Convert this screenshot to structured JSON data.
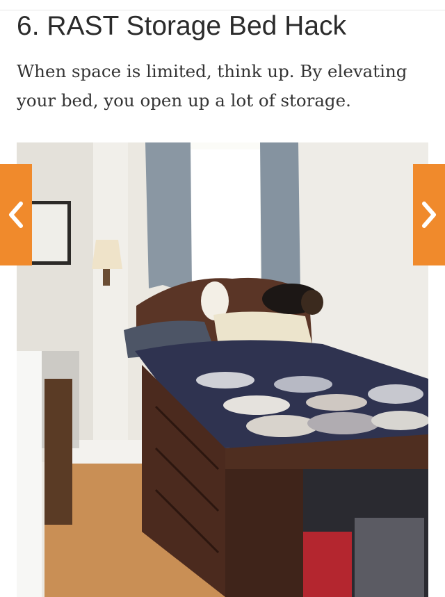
{
  "article": {
    "title": "6. RAST Storage Bed Hack",
    "description": "When space is limited, think up. By elevating your bed, you open up a lot of storage."
  },
  "gallery": {
    "prev_icon": "chevron-left-icon",
    "next_icon": "chevron-right-icon",
    "accent_color": "#f08a2c"
  }
}
